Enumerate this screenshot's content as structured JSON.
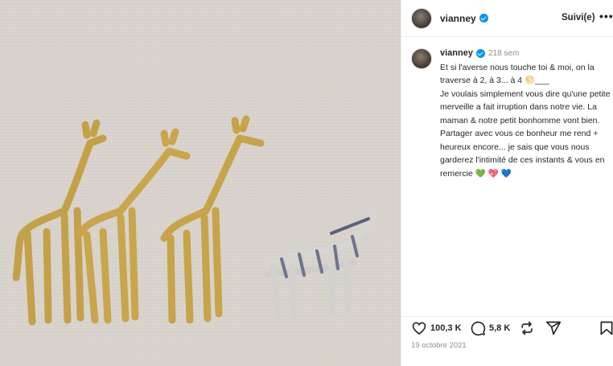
{
  "post": {
    "username": "vianney",
    "follow_label": "Suivi(e)",
    "more_label": "•••",
    "caption_time": "218 sem",
    "caption_text": "Et si l'averse nous touche toi & moi, on la traverse à 2, à 3... à 4 🌕___\nJe voulais simplement vous dire qu'une petite merveille a fait irruption dans notre vie. La maman & notre petit bonhomme vont bien. Partager avec vous ce bonheur me rend + heureux encore... je sais que vous nous garderez l'intimité de ces instants & vous en remercie 💚 💖 💙",
    "likes": "100,3 K",
    "comments": "5,8 K",
    "date": "19 octobre 2021"
  },
  "icons": {
    "verified": "verified-badge-icon",
    "like": "heart-icon",
    "comment": "comment-icon",
    "repost": "repost-icon",
    "share": "share-icon",
    "save": "bookmark-icon"
  },
  "colors": {
    "verified": "#0095f6",
    "text": "#262626",
    "muted": "#8e8e8e",
    "divider": "#efefef"
  }
}
